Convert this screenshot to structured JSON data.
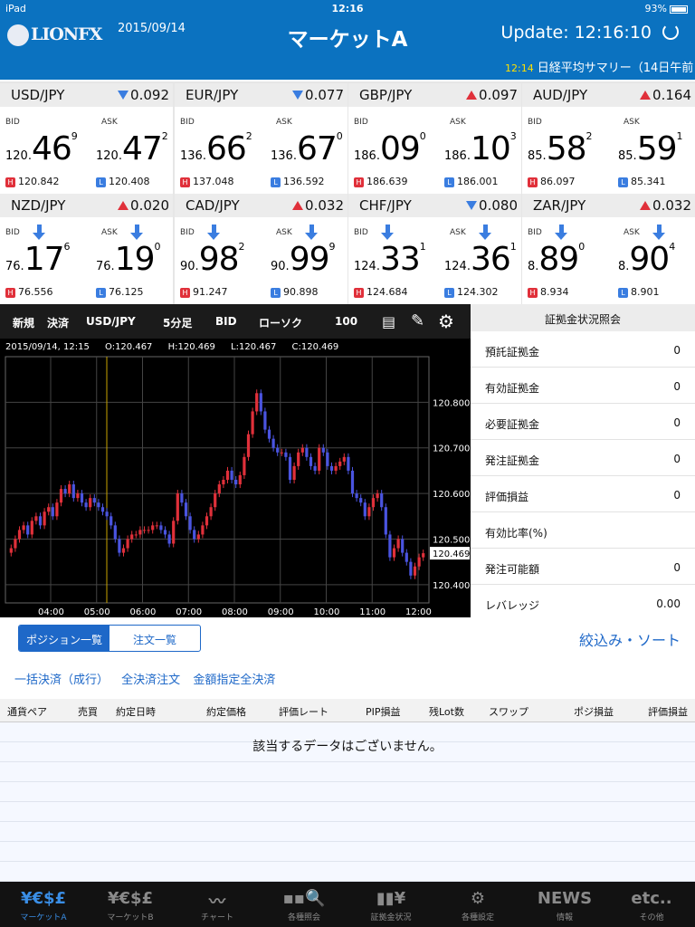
{
  "status": {
    "device": "iPad",
    "time": "12:16",
    "battery": "93%"
  },
  "header": {
    "logo": "LIONFX",
    "date": "2015/09/14",
    "title": "マーケットA",
    "update": "Update: 12:16:10",
    "ticker_time": "12:14",
    "ticker_text": "日経平均サマリー（14日午前"
  },
  "rates": [
    {
      "pair": "USD/JPY",
      "dir": "down",
      "change": "0.092",
      "bid_pre": "120.",
      "bid_big": "46",
      "bid_sup": "9",
      "ask_pre": "120.",
      "ask_big": "47",
      "ask_sup": "2",
      "high": "120.842",
      "low": "120.408",
      "arrows": false
    },
    {
      "pair": "EUR/JPY",
      "dir": "down",
      "change": "0.077",
      "bid_pre": "136.",
      "bid_big": "66",
      "bid_sup": "2",
      "ask_pre": "136.",
      "ask_big": "67",
      "ask_sup": "0",
      "high": "137.048",
      "low": "136.592",
      "arrows": false
    },
    {
      "pair": "GBP/JPY",
      "dir": "up",
      "change": "0.097",
      "bid_pre": "186.",
      "bid_big": "09",
      "bid_sup": "0",
      "ask_pre": "186.",
      "ask_big": "10",
      "ask_sup": "3",
      "high": "186.639",
      "low": "186.001",
      "arrows": false
    },
    {
      "pair": "AUD/JPY",
      "dir": "up",
      "change": "0.164",
      "bid_pre": "85.",
      "bid_big": "58",
      "bid_sup": "2",
      "ask_pre": "85.",
      "ask_big": "59",
      "ask_sup": "1",
      "high": "86.097",
      "low": "85.341",
      "arrows": false
    },
    {
      "pair": "NZD/JPY",
      "dir": "up",
      "change": "0.020",
      "bid_pre": "76.",
      "bid_big": "17",
      "bid_sup": "6",
      "ask_pre": "76.",
      "ask_big": "19",
      "ask_sup": "0",
      "high": "76.556",
      "low": "76.125",
      "arrows": true
    },
    {
      "pair": "CAD/JPY",
      "dir": "up",
      "change": "0.032",
      "bid_pre": "90.",
      "bid_big": "98",
      "bid_sup": "2",
      "ask_pre": "90.",
      "ask_big": "99",
      "ask_sup": "9",
      "high": "91.247",
      "low": "90.898",
      "arrows": true
    },
    {
      "pair": "CHF/JPY",
      "dir": "down",
      "change": "0.080",
      "bid_pre": "124.",
      "bid_big": "33",
      "bid_sup": "1",
      "ask_pre": "124.",
      "ask_big": "36",
      "ask_sup": "1",
      "high": "124.684",
      "low": "124.302",
      "arrows": true
    },
    {
      "pair": "ZAR/JPY",
      "dir": "up",
      "change": "0.032",
      "bid_pre": "8.",
      "bid_big": "89",
      "bid_sup": "0",
      "ask_pre": "8.",
      "ask_big": "90",
      "ask_sup": "4",
      "high": "8.934",
      "low": "8.901",
      "arrows": true
    }
  ],
  "labels": {
    "bid": "BID",
    "ask": "ASK",
    "h": "H",
    "l": "L"
  },
  "chart_toolbar": {
    "new": "新規",
    "settle": "決済",
    "pair": "USD/JPY",
    "interval": "5分足",
    "side": "BID",
    "type": "ローソク",
    "count": "100"
  },
  "chart_info": {
    "datetime": "2015/09/14, 12:15",
    "o": "O:120.467",
    "h": "H:120.469",
    "l": "L:120.467",
    "c": "C:120.469"
  },
  "chart_data": {
    "type": "candlestick",
    "y_ticks": [
      120.8,
      120.7,
      120.6,
      120.5,
      120.4
    ],
    "y_tick_labels": [
      "120.800",
      "120.700",
      "120.600",
      "120.500",
      "120.400"
    ],
    "ylim": [
      120.36,
      120.9
    ],
    "x_tick_labels": [
      "04:00",
      "05:00",
      "06:00",
      "07:00",
      "08:00",
      "09:00",
      "10:00",
      "11:00",
      "12:00"
    ],
    "current": 120.469,
    "current_label": "120.469",
    "closes": [
      120.48,
      120.5,
      120.52,
      120.53,
      120.51,
      120.54,
      120.55,
      120.53,
      120.56,
      120.57,
      120.55,
      120.58,
      120.61,
      120.6,
      120.62,
      120.59,
      120.6,
      120.58,
      120.57,
      120.59,
      120.58,
      120.57,
      120.56,
      120.55,
      120.53,
      120.5,
      120.47,
      120.48,
      120.5,
      120.51,
      120.51,
      120.52,
      120.52,
      120.52,
      120.53,
      120.53,
      120.52,
      120.51,
      120.49,
      120.54,
      120.6,
      120.58,
      120.55,
      120.52,
      120.5,
      120.51,
      120.53,
      120.55,
      120.57,
      120.6,
      120.62,
      120.63,
      120.65,
      120.63,
      120.62,
      120.64,
      120.68,
      120.73,
      120.78,
      120.82,
      120.78,
      120.74,
      120.72,
      120.7,
      120.69,
      120.69,
      120.68,
      120.63,
      120.66,
      120.69,
      120.7,
      120.68,
      120.66,
      120.65,
      120.7,
      120.69,
      120.66,
      120.65,
      120.66,
      120.67,
      120.68,
      120.65,
      120.6,
      120.59,
      120.58,
      120.55,
      120.57,
      120.59,
      120.6,
      120.57,
      120.51,
      120.46,
      120.48,
      120.5,
      120.47,
      120.45,
      120.42,
      120.44,
      120.46,
      120.469
    ]
  },
  "margin": {
    "title": "証拠金状況照会",
    "rows": [
      {
        "k": "預託証拠金",
        "v": "0"
      },
      {
        "k": "有効証拠金",
        "v": "0"
      },
      {
        "k": "必要証拠金",
        "v": "0"
      },
      {
        "k": "発注証拠金",
        "v": "0"
      },
      {
        "k": "評価損益",
        "v": "0"
      },
      {
        "k": "有効比率(%)",
        "v": ""
      },
      {
        "k": "発注可能額",
        "v": "0"
      },
      {
        "k": "レバレッジ",
        "v": "0.00"
      }
    ]
  },
  "positions": {
    "tab_positions": "ポジション一覧",
    "tab_orders": "注文一覧",
    "filter": "絞込み・ソート",
    "bulk_market": "一括決済（成行）",
    "settle_all": "全決済注文",
    "amount_settle": "金額指定全決済",
    "columns": [
      "通貨ペア",
      "売買",
      "約定日時",
      "約定価格",
      "評価レート",
      "PIP損益",
      "残Lot数",
      "スワップ",
      "ポジ損益",
      "評価損益"
    ],
    "empty": "該当するデータはございません。"
  },
  "tabs": [
    {
      "icon": "¥€$£",
      "label": "マーケットA"
    },
    {
      "icon": "¥€$£",
      "label": "マーケットB"
    },
    {
      "icon": "〰",
      "label": "チャート"
    },
    {
      "icon": "▪▪🔍",
      "label": "各種照会"
    },
    {
      "icon": "▮▮¥",
      "label": "証拠金状況"
    },
    {
      "icon": "⚙",
      "label": "各種設定"
    },
    {
      "icon": "NEWS",
      "label": "情報"
    },
    {
      "icon": "etc..",
      "label": "その他"
    }
  ]
}
